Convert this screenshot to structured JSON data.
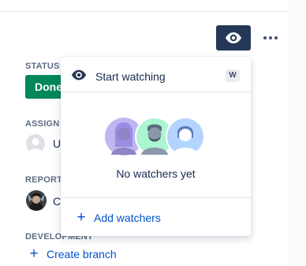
{
  "header": {
    "watch_icon": "eye-icon",
    "more_icon": "more-horizontal-icon"
  },
  "sidebar": {
    "status": {
      "label": "STATUS",
      "value": "Done"
    },
    "assignee": {
      "label": "ASSIGN",
      "value": "U"
    },
    "reporter": {
      "label": "REPORT",
      "value": "C"
    },
    "development": {
      "label": "DEVELOPMENT",
      "create_branch": "Create branch"
    }
  },
  "watch_popup": {
    "start_watching_label": "Start watching",
    "shortcut": "W",
    "empty_text": "No watchers yet",
    "add_watchers_label": "Add watchers"
  },
  "colors": {
    "watch_button_bg": "#253858",
    "status_done": "#00875a",
    "link": "#0052cc",
    "avatar_purple": "#c0b6f2",
    "avatar_green": "#abf5d1",
    "avatar_blue": "#b3d4ff"
  }
}
